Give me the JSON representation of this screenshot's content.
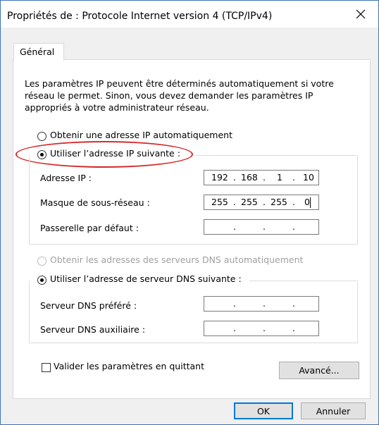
{
  "window": {
    "title": "Propriétés de : Protocole Internet version 4 (TCP/IPv4)",
    "close_glyph": "✕"
  },
  "tabs": [
    {
      "label": "Général",
      "active": true
    }
  ],
  "description": "Les paramètres IP peuvent être déterminés automatiquement si votre réseau le permet. Sinon, vous devez demander les paramètres IP appropriés à votre administrateur réseau.",
  "ip": {
    "auto_label": "Obtenir une adresse IP automatiquement",
    "manual_label": "Utiliser l’adresse IP suivante :",
    "selected": "manual",
    "fields": [
      {
        "label": "Adresse IP :",
        "octets": [
          "192",
          "168",
          "1",
          "10"
        ]
      },
      {
        "label": "Masque de sous-réseau :",
        "octets": [
          "255",
          "255",
          "255",
          "0"
        ]
      },
      {
        "label": "Passerelle par défaut :",
        "octets": [
          "",
          "",
          "",
          ""
        ]
      }
    ]
  },
  "dns": {
    "auto_label": "Obtenir les adresses des serveurs DNS automatiquement",
    "manual_label": "Utiliser l’adresse de serveur DNS suivante :",
    "selected": "manual",
    "auto_disabled": true,
    "fields": [
      {
        "label": "Serveur DNS préféré :",
        "octets": [
          "",
          "",
          "",
          ""
        ]
      },
      {
        "label": "Serveur DNS auxiliaire :",
        "octets": [
          "",
          "",
          "",
          ""
        ]
      }
    ]
  },
  "validate": {
    "label": "Valider les paramètres en quittant",
    "checked": false
  },
  "buttons": {
    "advanced": "Avancé...",
    "ok": "OK",
    "cancel": "Annuler"
  },
  "colors": {
    "annotation": "#d42a2a",
    "focus_border": "#0078d7",
    "frame": "#3f73b8"
  }
}
